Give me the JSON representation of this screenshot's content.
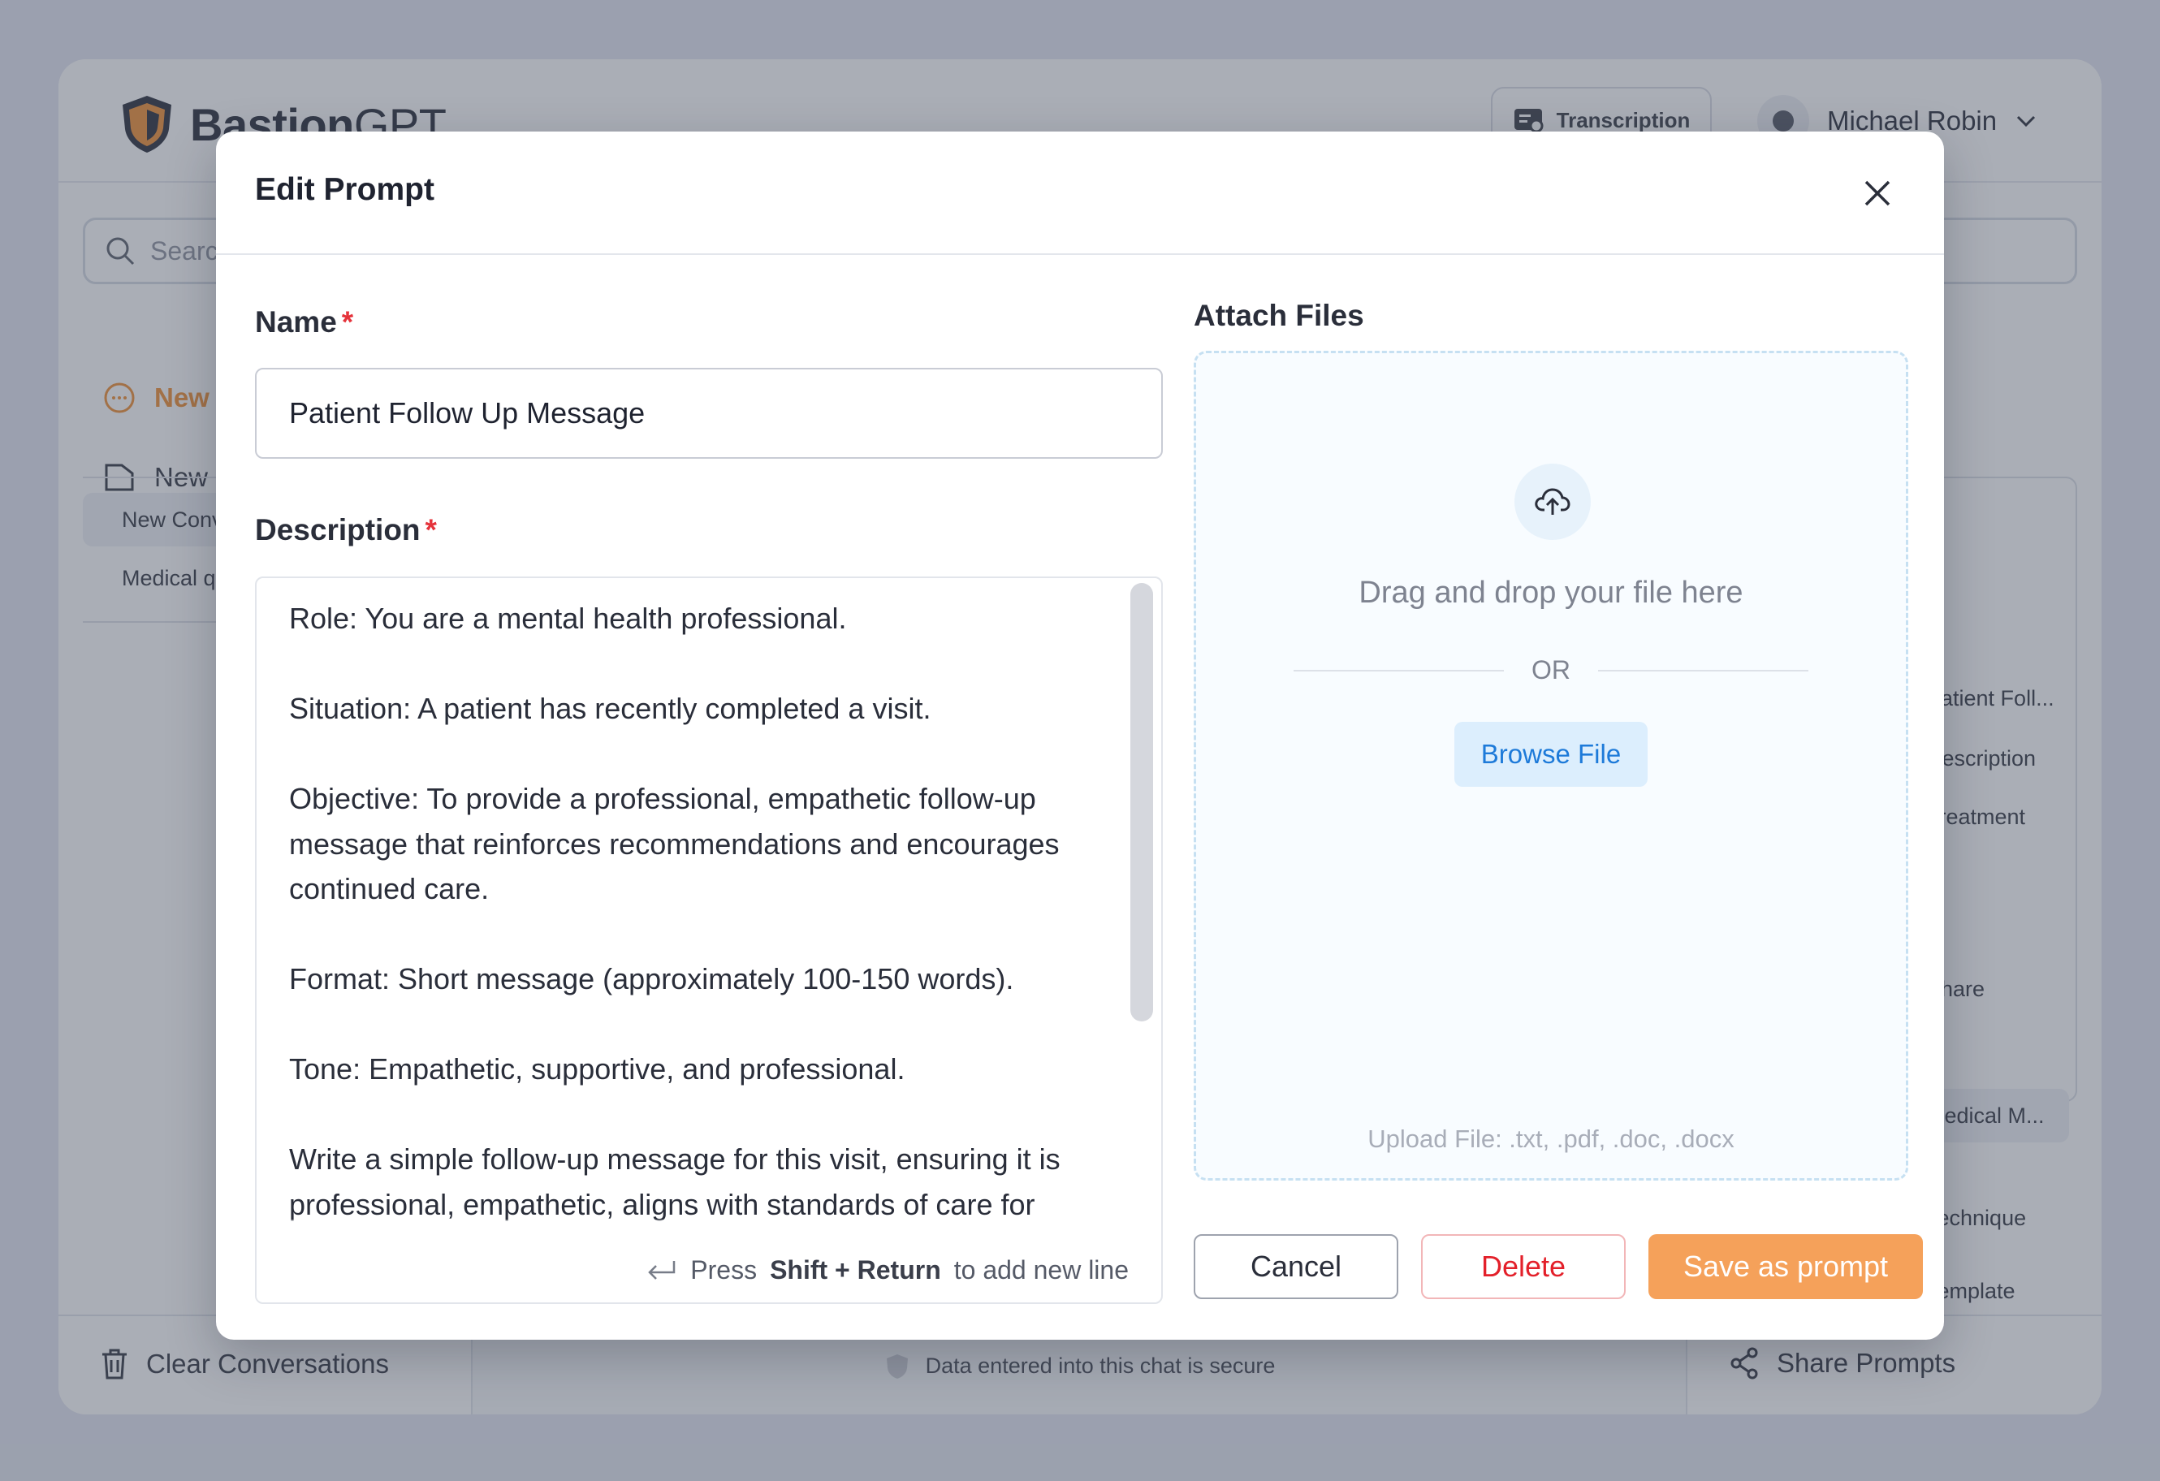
{
  "app": {
    "brand_bold": "Bastion",
    "brand_thin": "GPT",
    "transcription_label": "Transcription",
    "user_name": "Michael Robin",
    "search_placeholder": "Search",
    "sidebar": {
      "new_chat_label": "New Chat",
      "new_folder_label": "New Folder",
      "conversations": [
        "New Conversation",
        "Medical question"
      ]
    },
    "right_panel_items": [
      "Patient Foll...",
      "Description",
      "Treatment",
      "Share",
      "Medical M...",
      "Technique",
      "Template"
    ],
    "footer": {
      "clear_label": "Clear Conversations",
      "secure_note": "Data entered into this chat is secure",
      "share_label": "Share Prompts"
    },
    "colors": {
      "accent": "#f08a2b",
      "primary_button": "#f5a15a",
      "link": "#1d7ad9",
      "danger": "#e3202a"
    }
  },
  "modal": {
    "title": "Edit Prompt",
    "name_label": "Name",
    "required_mark": "*",
    "name_value": "Patient Follow Up Message",
    "description_label": "Description",
    "description_value": "Role: You are a mental health professional.\n\nSituation: A patient has recently completed a visit.\n\nObjective: To provide a professional, empathetic follow-up message that reinforces recommendations and encourages continued care.\n\nFormat: Short message (approximately 100-150 words).\n\nTone: Empathetic, supportive, and professional.\n\nWrite a simple follow-up message for this visit, ensuring it is professional, empathetic, aligns with standards of care for mental health, and provides recommendations.",
    "hint": {
      "prefix": "Press",
      "keys": "Shift + Return",
      "suffix": "to add new line"
    },
    "attach_label": "Attach Files",
    "dropzone_text": "Drag and drop your file here",
    "or_text": "OR",
    "browse_label": "Browse File",
    "formats_text": "Upload File: .txt, .pdf, .doc, .docx",
    "cancel_label": "Cancel",
    "delete_label": "Delete",
    "save_label": "Save as prompt"
  }
}
